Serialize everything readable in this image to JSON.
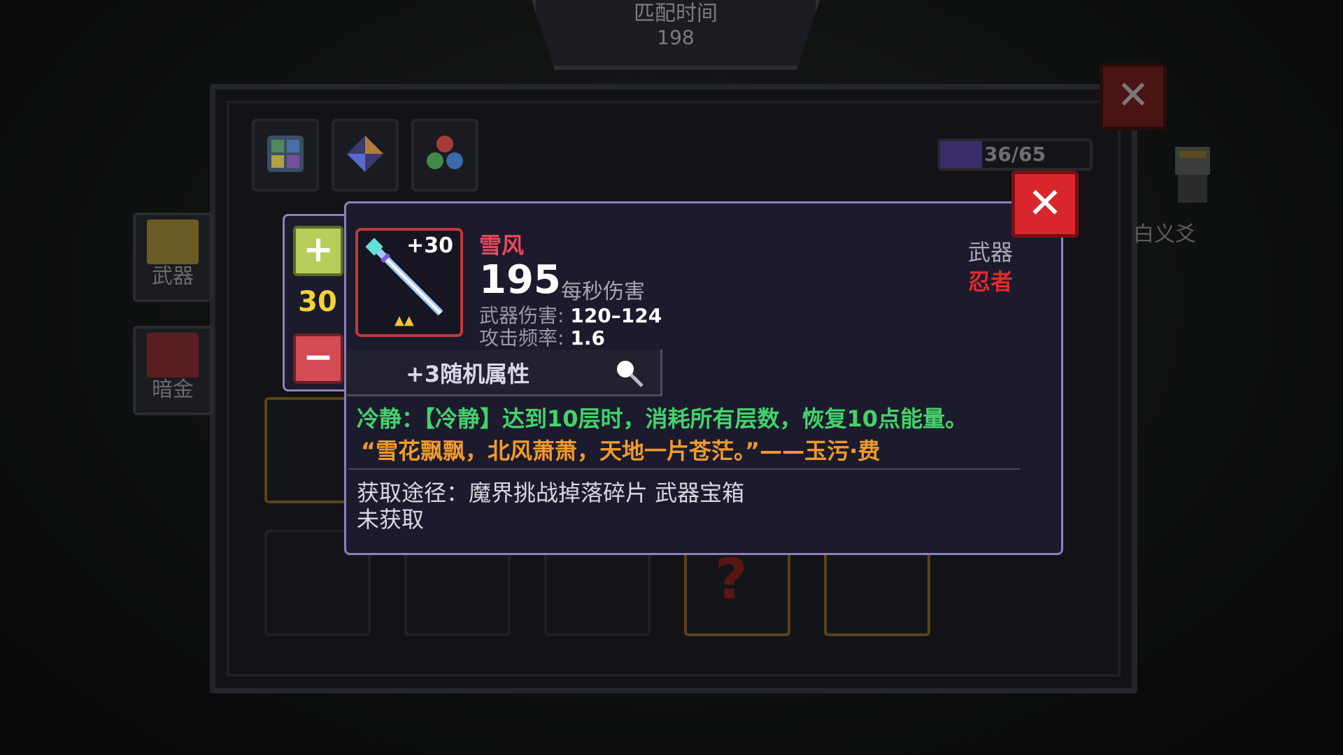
{
  "timer": {
    "label": "匹配时间",
    "value": "198"
  },
  "panel": {
    "progress_text": "36/65",
    "progress_fraction": 0.28,
    "side_tabs": [
      {
        "label": "武器",
        "icon": "weapon-chest-icon"
      },
      {
        "label": "暗金",
        "icon": "dark-gold-chest-icon"
      }
    ],
    "category_icons": [
      "grid-icon",
      "gem-icon",
      "orbs-icon"
    ],
    "right_character_name": "白义爻"
  },
  "stepper": {
    "plus_label": "+",
    "minus_label": "−",
    "value": "30"
  },
  "item": {
    "level": "+30",
    "name": "雪风",
    "dps": "195",
    "dps_label": "每秒伤害",
    "damage_label": "武器伤害:",
    "damage_value": "120–124",
    "rate_label": "攻击频率:",
    "rate_value": "1.6",
    "type": "武器",
    "class": "忍者",
    "random_attr": "+3随机属性",
    "skill": "冷静：【冷静】达到10层时，消耗所有层数，恢复10点能量。",
    "quote": "“雪花飘飘，北风萧萧，天地一片苍茫。”——玉污·费",
    "source": "获取途径：魔界挑战掉落碎片 武器宝箱",
    "status": "未获取"
  },
  "colors": {
    "accent_purple": "#8a82c0",
    "close_red": "#d8262c",
    "name_red": "#e8485a",
    "skill_green": "#43d36a",
    "quote_orange": "#f09a2b",
    "stepper_value": "#f4d23a"
  }
}
